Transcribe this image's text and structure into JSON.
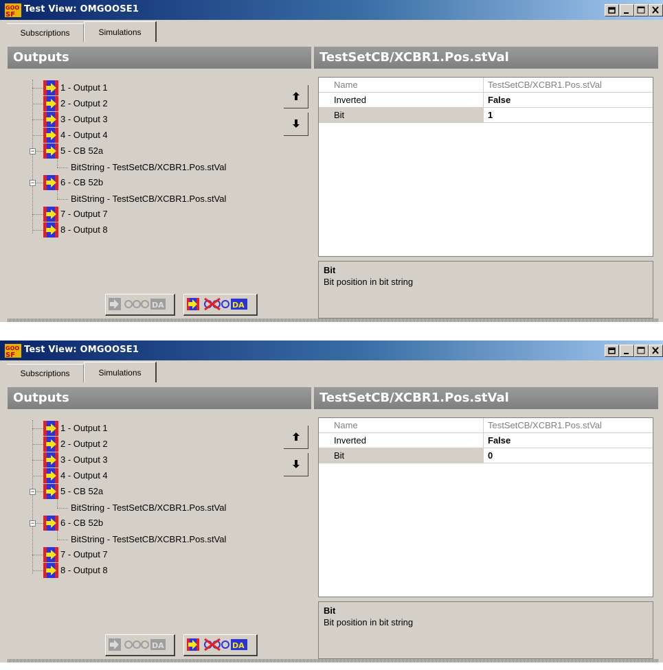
{
  "windows": [
    {
      "title": "Test View: OMGOOSE1",
      "tabs": [
        "Subscriptions",
        "Simulations"
      ],
      "active_tab": "Simulations",
      "outputs_header": "Outputs",
      "tree": [
        {
          "label": "1 - Output 1"
        },
        {
          "label": "2 - Output 2"
        },
        {
          "label": "3 - Output 3"
        },
        {
          "label": "4 - Output 4"
        },
        {
          "label": "5 - CB 52a",
          "expanded": true,
          "child": "BitString - TestSetCB/XCBR1.Pos.stVal",
          "child_selected": true
        },
        {
          "label": "6 - CB 52b",
          "expanded": true,
          "child": "BitString - TestSetCB/XCBR1.Pos.stVal",
          "child_selected": false
        },
        {
          "label": "7 - Output 7"
        },
        {
          "label": "8 - Output 8"
        }
      ],
      "props_header": "TestSetCB/XCBR1.Pos.stVal",
      "props": [
        {
          "name": "Name",
          "value": "TestSetCB/XCBR1.Pos.stVal"
        },
        {
          "name": "Inverted",
          "value": "False"
        },
        {
          "name": "Bit",
          "value": "1"
        }
      ],
      "desc_title": "Bit",
      "desc_text": "Bit position in bit string"
    },
    {
      "title": "Test View: OMGOOSE1",
      "tabs": [
        "Subscriptions",
        "Simulations"
      ],
      "active_tab": "Simulations",
      "outputs_header": "Outputs",
      "tree": [
        {
          "label": "1 - Output 1"
        },
        {
          "label": "2 - Output 2"
        },
        {
          "label": "3 - Output 3"
        },
        {
          "label": "4 - Output 4"
        },
        {
          "label": "5 - CB 52a",
          "expanded": true,
          "child": "BitString - TestSetCB/XCBR1.Pos.stVal",
          "child_selected": false
        },
        {
          "label": "6 - CB 52b",
          "expanded": true,
          "child": "BitString - TestSetCB/XCBR1.Pos.stVal",
          "child_selected": true
        },
        {
          "label": "7 - Output 7"
        },
        {
          "label": "8 - Output 8"
        }
      ],
      "props_header": "TestSetCB/XCBR1.Pos.stVal",
      "props": [
        {
          "name": "Name",
          "value": "TestSetCB/XCBR1.Pos.stVal"
        },
        {
          "name": "Inverted",
          "value": "False"
        },
        {
          "name": "Bit",
          "value": "0"
        }
      ],
      "desc_title": "Bit",
      "desc_text": "Bit position in bit string"
    }
  ],
  "icons": {
    "app": "goose-sf-app-icon",
    "output": "output-arrow-icon",
    "move_up": "arrow-up-icon",
    "move_down": "arrow-down-icon",
    "link": "link-data-attribute-icon",
    "unlink": "unlink-data-attribute-icon"
  },
  "colors": {
    "titlebar_start": "#0a246a",
    "titlebar_end": "#a6caf0",
    "header_gray": "#8a8a8a",
    "icon_red": "#e0202a",
    "icon_blue": "#2c34d8",
    "icon_yellow": "#f7e51a"
  }
}
